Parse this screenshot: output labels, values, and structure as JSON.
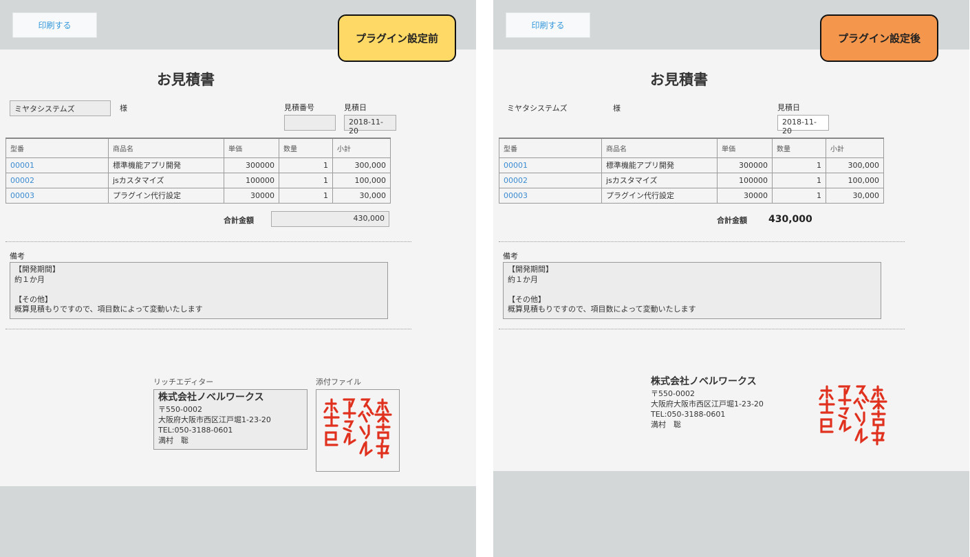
{
  "left": {
    "print_label": "印刷する",
    "tag": "プラグイン設定前",
    "title": "お見積書",
    "customer": "ミヤタシステムズ",
    "sama": "様",
    "quote_no_label": "見積番号",
    "quote_no_value": "",
    "date_label": "見積日",
    "date_value": "2018-11-20",
    "headers": [
      "型番",
      "商品名",
      "単価",
      "数量",
      "小計"
    ],
    "rows": [
      {
        "code": "00001",
        "name": "標準機能アプリ開発",
        "price": "300000",
        "qty": "1",
        "subtotal": "300,000"
      },
      {
        "code": "00002",
        "name": "jsカスタマイズ",
        "price": "100000",
        "qty": "1",
        "subtotal": "100,000"
      },
      {
        "code": "00003",
        "name": "プラグイン代行設定",
        "price": "30000",
        "qty": "1",
        "subtotal": "30,000"
      }
    ],
    "total_label": "合計金額",
    "total_value": "430,000",
    "remarks_label": "備考",
    "remarks_lines": [
      "【開発期間】",
      "約１か月",
      "",
      "【その他】",
      "概算見積もりですので、項目数によって変動いたします"
    ],
    "rich_editor_label": "リッチエディター",
    "attach_label": "添付ファイル",
    "company": {
      "name": "株式会社ノベルワークス",
      "zip": "〒550-0002",
      "address": "大阪府大阪市西区江戸堀1-23-20",
      "tel": "TEL:050-3188-0601",
      "person": "満村　聡"
    },
    "stamp_text": "株式会社ノベルワークス"
  },
  "right": {
    "print_label": "印刷する",
    "tag": "プラグイン設定後",
    "title": "お見積書",
    "customer": "ミヤタシステムズ",
    "sama": "様",
    "date_label": "見積日",
    "date_value": "2018-11-20",
    "headers": [
      "型番",
      "商品名",
      "単価",
      "数量",
      "小計"
    ],
    "rows": [
      {
        "code": "00001",
        "name": "標準機能アプリ開発",
        "price": "300000",
        "qty": "1",
        "subtotal": "300,000"
      },
      {
        "code": "00002",
        "name": "jsカスタマイズ",
        "price": "100000",
        "qty": "1",
        "subtotal": "100,000"
      },
      {
        "code": "00003",
        "name": "プラグイン代行設定",
        "price": "30000",
        "qty": "1",
        "subtotal": "30,000"
      }
    ],
    "total_label": "合計金額",
    "total_value": "430,000",
    "remarks_label": "備考",
    "remarks_lines": [
      "【開発期間】",
      "約１か月",
      "",
      "【その他】",
      "概算見積もりですので、項目数によって変動いたします"
    ],
    "company": {
      "name": "株式会社ノベルワークス",
      "zip": "〒550-0002",
      "address": "大阪府大阪市西区江戸堀1-23-20",
      "tel": "TEL:050-3188-0601",
      "person": "満村　聡"
    },
    "stamp_text": "株式会社ノベルワークス"
  },
  "colors": {
    "tag_before": "#ffd966",
    "tag_after": "#f4964c",
    "link": "#3b8bd1",
    "stamp": "#e0301e",
    "frame": "#d4d7d8"
  }
}
